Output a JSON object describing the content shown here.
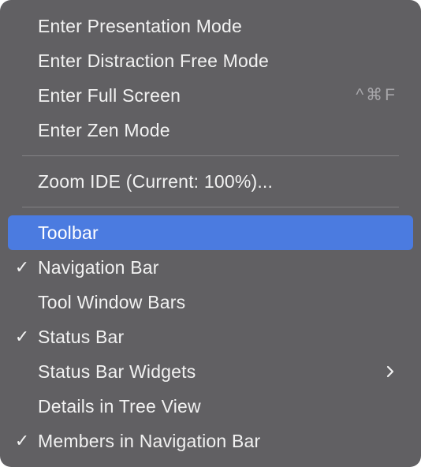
{
  "menu": {
    "items": [
      {
        "label": "Enter Presentation Mode"
      },
      {
        "label": "Enter Distraction Free Mode"
      },
      {
        "label": "Enter Full Screen",
        "shortcut": "^⌘F"
      },
      {
        "label": "Enter Zen Mode"
      },
      {
        "label": "Zoom IDE (Current: 100%)..."
      },
      {
        "label": "Toolbar",
        "highlighted": true
      },
      {
        "label": "Navigation Bar",
        "checked": true,
        "check": "✓"
      },
      {
        "label": "Tool Window Bars"
      },
      {
        "label": "Status Bar",
        "checked": true,
        "check": "✓"
      },
      {
        "label": "Status Bar Widgets",
        "submenu_icon": "chevron-right-icon"
      },
      {
        "label": "Details in Tree View"
      },
      {
        "label": "Members in Navigation Bar",
        "checked": true,
        "check": "✓"
      }
    ]
  },
  "colors": {
    "menu_background": "#616063",
    "highlight": "#4b7be0",
    "text": "#f2f2f2",
    "shortcut_text": "#a7a6aa",
    "separator": "#828184"
  }
}
